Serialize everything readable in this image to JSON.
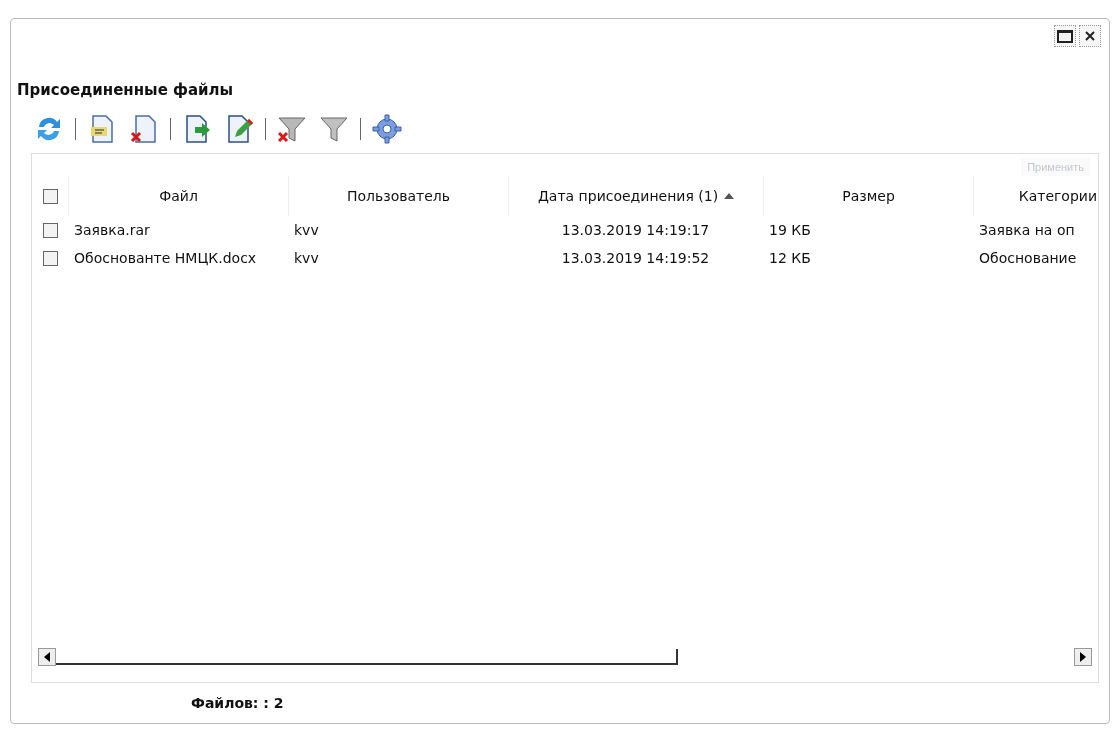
{
  "window": {
    "title": "Присоединенные файлы"
  },
  "apply_button": {
    "label": "Применить",
    "disabled": true
  },
  "table": {
    "select_all": {
      "checked": false
    },
    "columns": [
      {
        "label": "Файл",
        "sorted": false
      },
      {
        "label": "Пользователь",
        "sorted": false
      },
      {
        "label": "Дата присоединения (1)",
        "sorted": true
      },
      {
        "label": "Размер",
        "sorted": false
      },
      {
        "label": "Категории",
        "sorted": false
      }
    ],
    "rows": [
      {
        "checked": false,
        "cells": [
          "Заявка.rar",
          "kvv",
          "13.03.2019 14:19:17",
          "19 КБ",
          "Заявка на оп"
        ]
      },
      {
        "checked": false,
        "cells": [
          "Обосновантe НМЦК.docx",
          "kvv",
          "13.03.2019 14:19:52",
          "12 КБ",
          "Обоснование"
        ]
      }
    ]
  },
  "status_bar": {
    "text": "Файлов: : 2"
  }
}
